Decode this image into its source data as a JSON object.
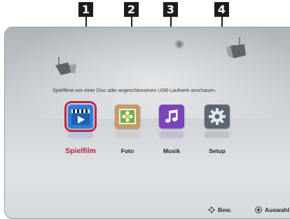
{
  "callouts": [
    "1",
    "2",
    "3",
    "4"
  ],
  "home": {
    "prompt": "Spielfilme von einer Disc oder angeschlossenen USB-Laufwerk anschauen.",
    "items": [
      {
        "label": "Spielfilm",
        "icon": "clapperboard-icon",
        "color": "#2f7fd6",
        "selected": true
      },
      {
        "label": "Foto",
        "icon": "photo-flower-icon",
        "color": "#c89a6a",
        "selected": false
      },
      {
        "label": "Musik",
        "icon": "music-note-icon",
        "color": "#7b45b8",
        "selected": false
      },
      {
        "label": "Setup",
        "icon": "gear-icon",
        "color": "#5c6670",
        "selected": false
      }
    ]
  },
  "footer": {
    "move_label": "Bew.",
    "select_label": "Auswahl"
  },
  "colors": {
    "accent": "#c0254c",
    "background": "#cfd3d6"
  }
}
